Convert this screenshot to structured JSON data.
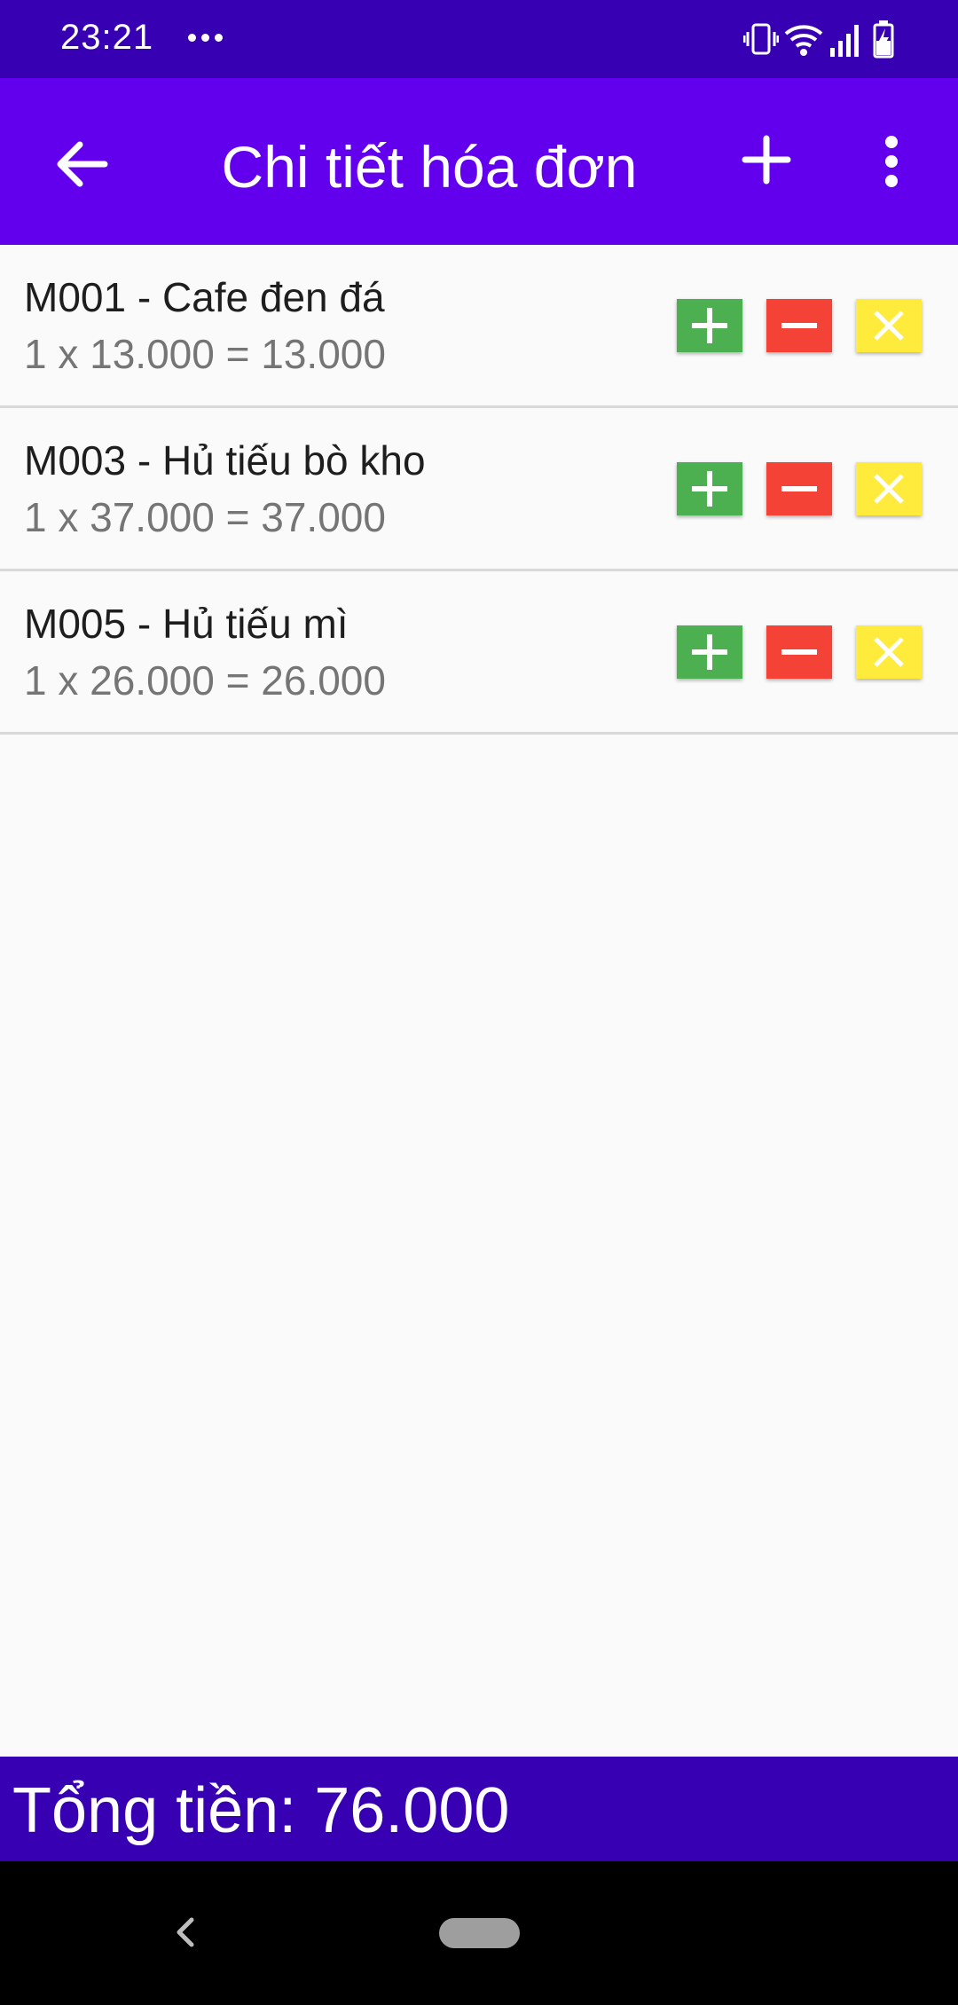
{
  "status_bar": {
    "time": "23:21",
    "more_icon": "three-dots-icon",
    "icons": [
      "vibrate-icon",
      "wifi-icon",
      "signal-icon",
      "battery-charging-icon"
    ]
  },
  "app_bar": {
    "title": "Chi tiết hóa đơn",
    "back_icon": "arrow-back-icon",
    "add_icon": "plus-icon",
    "menu_icon": "more-vert-icon",
    "color": "#6200ee"
  },
  "items": [
    {
      "title": "M001 - Cafe đen đá",
      "detail": "1 x 13.000 = 13.000"
    },
    {
      "title": "M003 - Hủ tiếu bò kho",
      "detail": "1 x 37.000 = 37.000"
    },
    {
      "title": "M005 - Hủ tiếu mì",
      "detail": "1 x 26.000 = 26.000"
    }
  ],
  "item_actions": {
    "increase": {
      "icon": "plus-icon",
      "color": "#4caf50"
    },
    "decrease": {
      "icon": "minus-icon",
      "color": "#f44336"
    },
    "remove": {
      "icon": "close-icon",
      "color": "#ffeb3b"
    }
  },
  "total": {
    "text": "Tổng tiền: 76.000",
    "color": "#3700b3"
  },
  "nav_bar": {
    "back_icon": "nav-back-icon",
    "home_icon": "home-pill-icon"
  }
}
